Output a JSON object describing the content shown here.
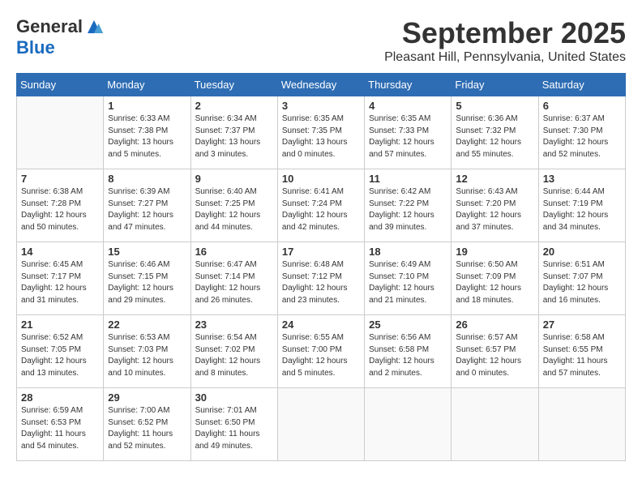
{
  "logo": {
    "general": "General",
    "blue": "Blue"
  },
  "title": "September 2025",
  "location": "Pleasant Hill, Pennsylvania, United States",
  "days_of_week": [
    "Sunday",
    "Monday",
    "Tuesday",
    "Wednesday",
    "Thursday",
    "Friday",
    "Saturday"
  ],
  "weeks": [
    [
      {
        "day": "",
        "info": ""
      },
      {
        "day": "1",
        "info": "Sunrise: 6:33 AM\nSunset: 7:38 PM\nDaylight: 13 hours\nand 5 minutes."
      },
      {
        "day": "2",
        "info": "Sunrise: 6:34 AM\nSunset: 7:37 PM\nDaylight: 13 hours\nand 3 minutes."
      },
      {
        "day": "3",
        "info": "Sunrise: 6:35 AM\nSunset: 7:35 PM\nDaylight: 13 hours\nand 0 minutes."
      },
      {
        "day": "4",
        "info": "Sunrise: 6:35 AM\nSunset: 7:33 PM\nDaylight: 12 hours\nand 57 minutes."
      },
      {
        "day": "5",
        "info": "Sunrise: 6:36 AM\nSunset: 7:32 PM\nDaylight: 12 hours\nand 55 minutes."
      },
      {
        "day": "6",
        "info": "Sunrise: 6:37 AM\nSunset: 7:30 PM\nDaylight: 12 hours\nand 52 minutes."
      }
    ],
    [
      {
        "day": "7",
        "info": "Sunrise: 6:38 AM\nSunset: 7:28 PM\nDaylight: 12 hours\nand 50 minutes."
      },
      {
        "day": "8",
        "info": "Sunrise: 6:39 AM\nSunset: 7:27 PM\nDaylight: 12 hours\nand 47 minutes."
      },
      {
        "day": "9",
        "info": "Sunrise: 6:40 AM\nSunset: 7:25 PM\nDaylight: 12 hours\nand 44 minutes."
      },
      {
        "day": "10",
        "info": "Sunrise: 6:41 AM\nSunset: 7:24 PM\nDaylight: 12 hours\nand 42 minutes."
      },
      {
        "day": "11",
        "info": "Sunrise: 6:42 AM\nSunset: 7:22 PM\nDaylight: 12 hours\nand 39 minutes."
      },
      {
        "day": "12",
        "info": "Sunrise: 6:43 AM\nSunset: 7:20 PM\nDaylight: 12 hours\nand 37 minutes."
      },
      {
        "day": "13",
        "info": "Sunrise: 6:44 AM\nSunset: 7:19 PM\nDaylight: 12 hours\nand 34 minutes."
      }
    ],
    [
      {
        "day": "14",
        "info": "Sunrise: 6:45 AM\nSunset: 7:17 PM\nDaylight: 12 hours\nand 31 minutes."
      },
      {
        "day": "15",
        "info": "Sunrise: 6:46 AM\nSunset: 7:15 PM\nDaylight: 12 hours\nand 29 minutes."
      },
      {
        "day": "16",
        "info": "Sunrise: 6:47 AM\nSunset: 7:14 PM\nDaylight: 12 hours\nand 26 minutes."
      },
      {
        "day": "17",
        "info": "Sunrise: 6:48 AM\nSunset: 7:12 PM\nDaylight: 12 hours\nand 23 minutes."
      },
      {
        "day": "18",
        "info": "Sunrise: 6:49 AM\nSunset: 7:10 PM\nDaylight: 12 hours\nand 21 minutes."
      },
      {
        "day": "19",
        "info": "Sunrise: 6:50 AM\nSunset: 7:09 PM\nDaylight: 12 hours\nand 18 minutes."
      },
      {
        "day": "20",
        "info": "Sunrise: 6:51 AM\nSunset: 7:07 PM\nDaylight: 12 hours\nand 16 minutes."
      }
    ],
    [
      {
        "day": "21",
        "info": "Sunrise: 6:52 AM\nSunset: 7:05 PM\nDaylight: 12 hours\nand 13 minutes."
      },
      {
        "day": "22",
        "info": "Sunrise: 6:53 AM\nSunset: 7:03 PM\nDaylight: 12 hours\nand 10 minutes."
      },
      {
        "day": "23",
        "info": "Sunrise: 6:54 AM\nSunset: 7:02 PM\nDaylight: 12 hours\nand 8 minutes."
      },
      {
        "day": "24",
        "info": "Sunrise: 6:55 AM\nSunset: 7:00 PM\nDaylight: 12 hours\nand 5 minutes."
      },
      {
        "day": "25",
        "info": "Sunrise: 6:56 AM\nSunset: 6:58 PM\nDaylight: 12 hours\nand 2 minutes."
      },
      {
        "day": "26",
        "info": "Sunrise: 6:57 AM\nSunset: 6:57 PM\nDaylight: 12 hours\nand 0 minutes."
      },
      {
        "day": "27",
        "info": "Sunrise: 6:58 AM\nSunset: 6:55 PM\nDaylight: 11 hours\nand 57 minutes."
      }
    ],
    [
      {
        "day": "28",
        "info": "Sunrise: 6:59 AM\nSunset: 6:53 PM\nDaylight: 11 hours\nand 54 minutes."
      },
      {
        "day": "29",
        "info": "Sunrise: 7:00 AM\nSunset: 6:52 PM\nDaylight: 11 hours\nand 52 minutes."
      },
      {
        "day": "30",
        "info": "Sunrise: 7:01 AM\nSunset: 6:50 PM\nDaylight: 11 hours\nand 49 minutes."
      },
      {
        "day": "",
        "info": ""
      },
      {
        "day": "",
        "info": ""
      },
      {
        "day": "",
        "info": ""
      },
      {
        "day": "",
        "info": ""
      }
    ]
  ]
}
